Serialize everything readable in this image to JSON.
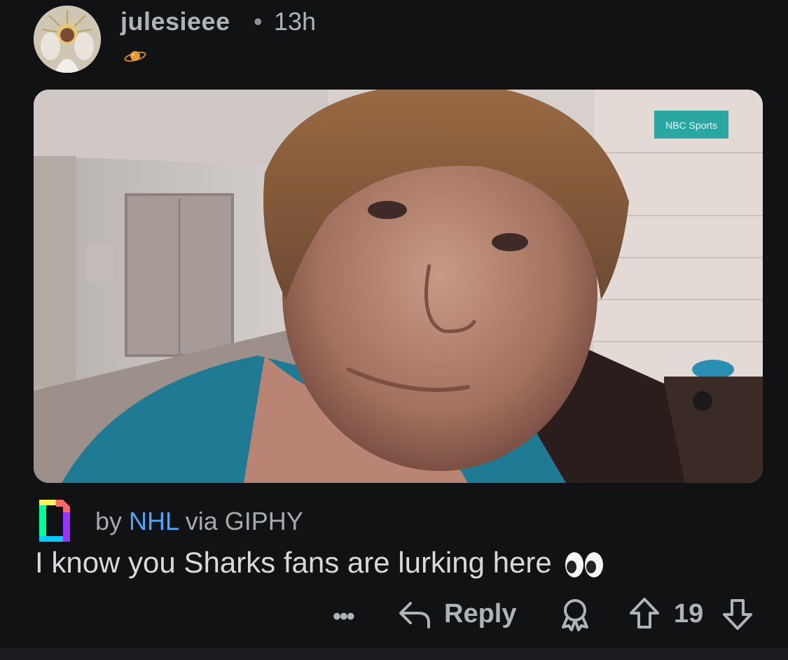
{
  "comment": {
    "username": "julesieee",
    "separator": "•",
    "time": "13h",
    "body": "I know you Sharks fans are lurking here",
    "media": {
      "alt": "GIF of a smiling young man in a blue hoodie in a hallway",
      "watermark": "NBC Sports"
    },
    "attribution": {
      "prefix": "by",
      "author": "NHL",
      "suffix": "via GIPHY"
    }
  },
  "actions": {
    "more": "•••",
    "reply": "Reply",
    "score": "19"
  },
  "colors": {
    "background": "#111214",
    "text": "#d7dadc",
    "muted": "#aeb3b8",
    "link": "#4ea3ff"
  },
  "icons": [
    "avatar",
    "flair-icon",
    "giphy-icon",
    "eyes-emoji",
    "more-icon",
    "reply-icon",
    "award-icon",
    "upvote-icon",
    "downvote-icon"
  ]
}
